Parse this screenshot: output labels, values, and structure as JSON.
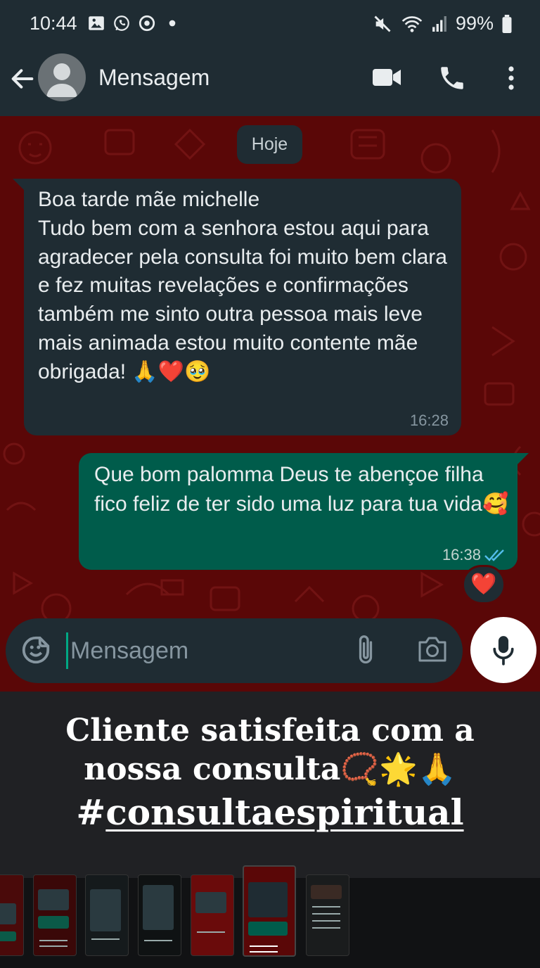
{
  "status_bar": {
    "time": "10:44",
    "battery": "99%",
    "left_icons": [
      "image-icon",
      "whatsapp-icon",
      "chrome-icon",
      "dot-icon"
    ],
    "right_icons": [
      "mute-icon",
      "wifi-icon",
      "signal-icon",
      "battery-icon"
    ]
  },
  "header": {
    "contact_name": "Mensagem",
    "icons": [
      "back-arrow-icon",
      "avatar",
      "video-call-icon",
      "phone-icon",
      "more-menu-icon"
    ]
  },
  "chat": {
    "date_chip": "Hoje",
    "messages": [
      {
        "direction": "incoming",
        "text": "Boa tarde mãe michelle\nTudo bem com a senhora estou aqui para agradecer pela consulta foi muito bem clara e fez muitas revelações e confirmações também me sinto outra pessoa mais leve mais animada estou muito contente mãe obrigada! 🙏❤️🥹",
        "time": "16:28"
      },
      {
        "direction": "outgoing",
        "text": "Que bom palomma Deus te abençoe filha fico feliz de ter sido uma luz para tua vida🥰",
        "time": "16:38",
        "status": "read",
        "reaction": "❤️"
      }
    ]
  },
  "composer": {
    "placeholder": "Mensagem"
  },
  "caption": {
    "line1": "Cliente satisfeita com a",
    "line2": "nossa consulta📿🌟🙏",
    "hash": "#",
    "hashtag": "consultaespiritual"
  },
  "thumbnails": {
    "count": 8,
    "active_index": 6,
    "active_caption": "Cliente satisfeita com a nossa consulta #consultaespiritual"
  },
  "colors": {
    "header_bg": "#1f2c33",
    "chat_bg": "#5a0707",
    "incoming_bubble": "#1f2c33",
    "outgoing_bubble": "#005c4b",
    "read_ticks": "#53bdeb",
    "caption_bg": "#202124"
  }
}
